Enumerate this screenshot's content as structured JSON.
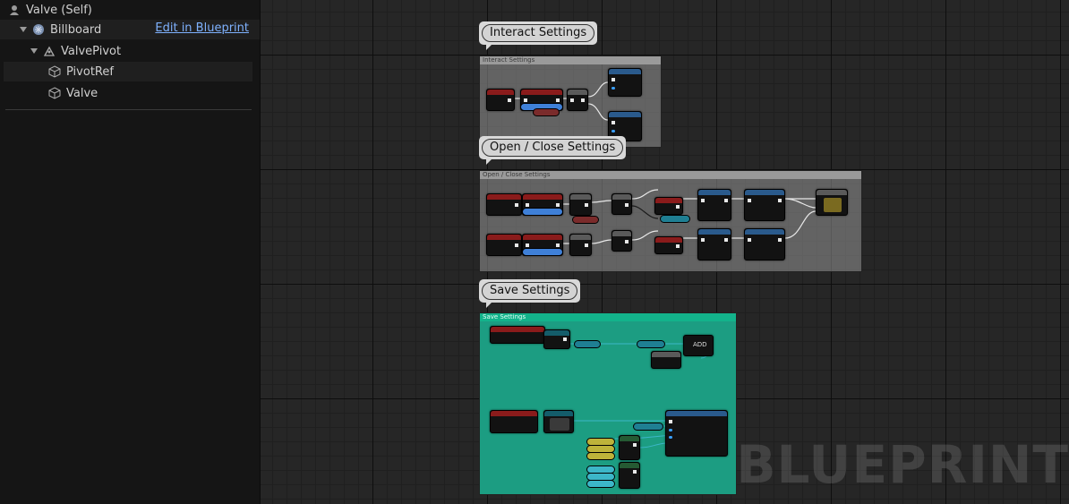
{
  "components_panel": {
    "root": {
      "label": "Valve (Self)",
      "icon": "person-icon"
    },
    "items": [
      {
        "label": "Billboard",
        "icon": "billboard-icon"
      },
      {
        "label": "ValvePivot",
        "icon": "pivot-icon"
      },
      {
        "label": "PivotRef",
        "icon": "cube-icon"
      },
      {
        "label": "Valve",
        "icon": "cube-icon"
      }
    ],
    "edit_link": "Edit in Blueprint"
  },
  "graph": {
    "watermark": "BLUEPRINT",
    "comments": [
      {
        "bubble": "Interact Settings",
        "header": "Interact Settings",
        "color": "#9a9a9a"
      },
      {
        "bubble": "Open / Close Settings",
        "header": "Open / Close Settings",
        "color": "#9a9a9a"
      },
      {
        "bubble": "Save Settings",
        "header": "Save Settings",
        "color": "#13b38b"
      }
    ],
    "add_node": "ADD"
  }
}
